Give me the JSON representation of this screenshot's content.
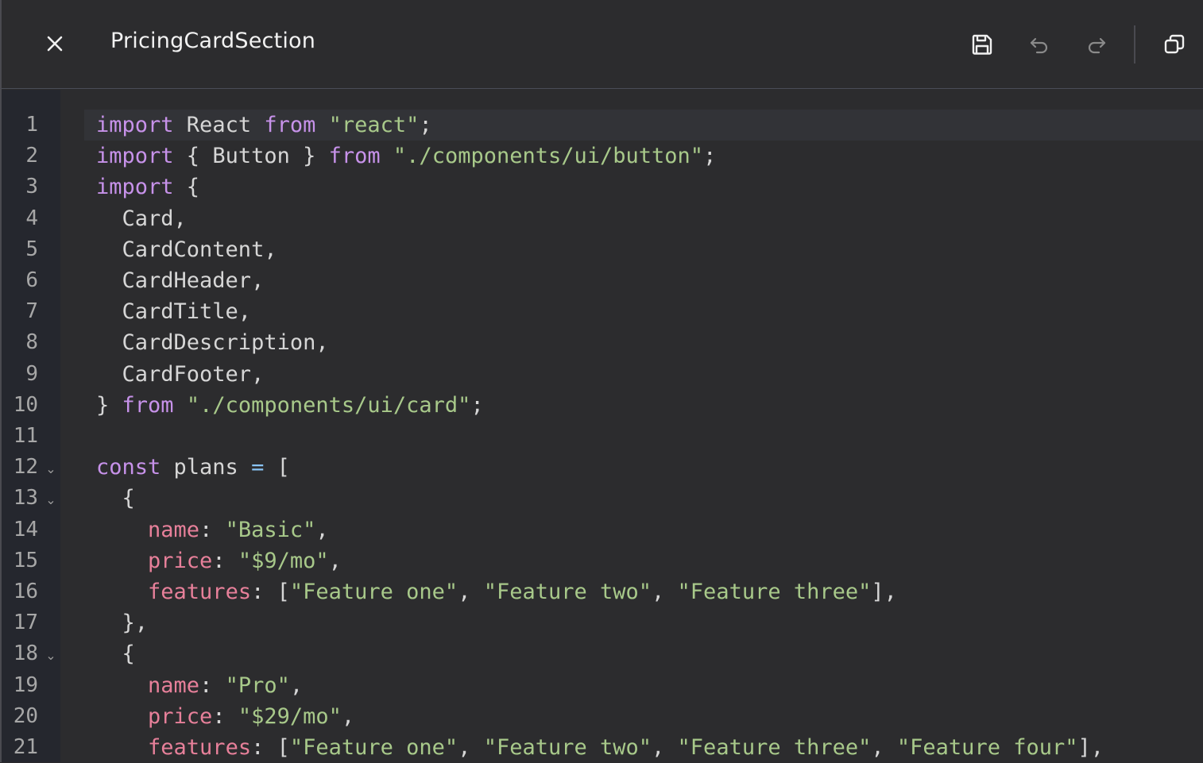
{
  "header": {
    "title": "PricingCardSection",
    "close_icon": "close-icon",
    "save_icon": "save-icon",
    "undo_icon": "undo-icon",
    "redo_icon": "redo-icon",
    "copy_icon": "copy-icon"
  },
  "editor": {
    "current_line": 1,
    "lines": [
      {
        "n": "1",
        "fold": false,
        "tokens": [
          [
            "kw",
            "import"
          ],
          [
            "id",
            " React "
          ],
          [
            "kw",
            "from"
          ],
          [
            "id",
            " "
          ],
          [
            "str",
            "\"react\""
          ],
          [
            "pn",
            ";"
          ]
        ]
      },
      {
        "n": "2",
        "fold": false,
        "tokens": [
          [
            "kw",
            "import"
          ],
          [
            "id",
            " { Button } "
          ],
          [
            "kw",
            "from"
          ],
          [
            "id",
            " "
          ],
          [
            "str",
            "\"./components/ui/button\""
          ],
          [
            "pn",
            ";"
          ]
        ]
      },
      {
        "n": "3",
        "fold": false,
        "tokens": [
          [
            "kw",
            "import"
          ],
          [
            "id",
            " {"
          ]
        ]
      },
      {
        "n": "4",
        "fold": false,
        "tokens": [
          [
            "id",
            "  Card,"
          ]
        ]
      },
      {
        "n": "5",
        "fold": false,
        "tokens": [
          [
            "id",
            "  CardContent,"
          ]
        ]
      },
      {
        "n": "6",
        "fold": false,
        "tokens": [
          [
            "id",
            "  CardHeader,"
          ]
        ]
      },
      {
        "n": "7",
        "fold": false,
        "tokens": [
          [
            "id",
            "  CardTitle,"
          ]
        ]
      },
      {
        "n": "8",
        "fold": false,
        "tokens": [
          [
            "id",
            "  CardDescription,"
          ]
        ]
      },
      {
        "n": "9",
        "fold": false,
        "tokens": [
          [
            "id",
            "  CardFooter,"
          ]
        ]
      },
      {
        "n": "10",
        "fold": false,
        "tokens": [
          [
            "id",
            "} "
          ],
          [
            "kw",
            "from"
          ],
          [
            "id",
            " "
          ],
          [
            "str",
            "\"./components/ui/card\""
          ],
          [
            "pn",
            ";"
          ]
        ]
      },
      {
        "n": "11",
        "fold": false,
        "tokens": []
      },
      {
        "n": "12",
        "fold": true,
        "tokens": [
          [
            "kw",
            "const"
          ],
          [
            "id",
            " plans "
          ],
          [
            "op",
            "="
          ],
          [
            "id",
            " ["
          ]
        ]
      },
      {
        "n": "13",
        "fold": true,
        "tokens": [
          [
            "id",
            "  {"
          ]
        ]
      },
      {
        "n": "14",
        "fold": false,
        "tokens": [
          [
            "id",
            "    "
          ],
          [
            "prop",
            "name"
          ],
          [
            "pn",
            ": "
          ],
          [
            "str",
            "\"Basic\""
          ],
          [
            "pn",
            ","
          ]
        ]
      },
      {
        "n": "15",
        "fold": false,
        "tokens": [
          [
            "id",
            "    "
          ],
          [
            "prop",
            "price"
          ],
          [
            "pn",
            ": "
          ],
          [
            "str",
            "\"$9/mo\""
          ],
          [
            "pn",
            ","
          ]
        ]
      },
      {
        "n": "16",
        "fold": false,
        "tokens": [
          [
            "id",
            "    "
          ],
          [
            "prop",
            "features"
          ],
          [
            "pn",
            ": ["
          ],
          [
            "str",
            "\"Feature one\""
          ],
          [
            "pn",
            ", "
          ],
          [
            "str",
            "\"Feature two\""
          ],
          [
            "pn",
            ", "
          ],
          [
            "str",
            "\"Feature three\""
          ],
          [
            "pn",
            "],"
          ]
        ]
      },
      {
        "n": "17",
        "fold": false,
        "tokens": [
          [
            "id",
            "  },"
          ]
        ]
      },
      {
        "n": "18",
        "fold": true,
        "tokens": [
          [
            "id",
            "  {"
          ]
        ]
      },
      {
        "n": "19",
        "fold": false,
        "tokens": [
          [
            "id",
            "    "
          ],
          [
            "prop",
            "name"
          ],
          [
            "pn",
            ": "
          ],
          [
            "str",
            "\"Pro\""
          ],
          [
            "pn",
            ","
          ]
        ]
      },
      {
        "n": "20",
        "fold": false,
        "tokens": [
          [
            "id",
            "    "
          ],
          [
            "prop",
            "price"
          ],
          [
            "pn",
            ": "
          ],
          [
            "str",
            "\"$29/mo\""
          ],
          [
            "pn",
            ","
          ]
        ]
      },
      {
        "n": "21",
        "fold": false,
        "tokens": [
          [
            "id",
            "    "
          ],
          [
            "prop",
            "features"
          ],
          [
            "pn",
            ": ["
          ],
          [
            "str",
            "\"Feature one\""
          ],
          [
            "pn",
            ", "
          ],
          [
            "str",
            "\"Feature two\""
          ],
          [
            "pn",
            ", "
          ],
          [
            "str",
            "\"Feature three\""
          ],
          [
            "pn",
            ", "
          ],
          [
            "str",
            "\"Feature four\""
          ],
          [
            "pn",
            "],"
          ]
        ]
      }
    ]
  },
  "colors": {
    "background": "#2c2c2e",
    "gutter": "#25272e",
    "keyword": "#c792ea",
    "string": "#a8c98a",
    "property": "#e7809a",
    "operator": "#89c4f4",
    "text": "#d6d6d6"
  }
}
